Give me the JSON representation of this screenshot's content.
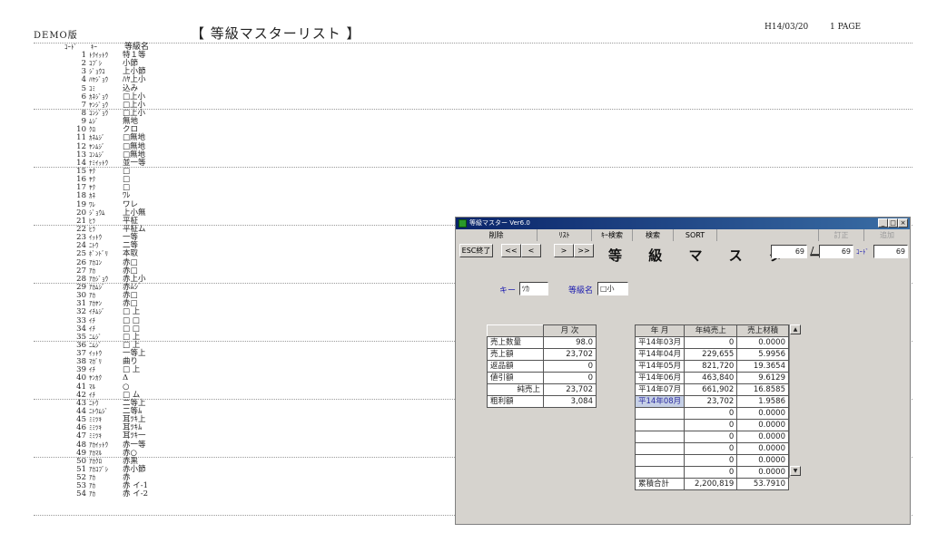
{
  "report": {
    "demo_label": "DEMO版",
    "title": "【 等級マスターリスト 】",
    "date": "H14/03/20",
    "page": "1 PAGE",
    "headers": {
      "code": "ｺｰﾄﾞ",
      "key": "ｷｰ",
      "name": "等級名"
    },
    "rows": [
      {
        "code": "1",
        "key": "ﾄｸｲｯﾄｳ",
        "name": "特１等"
      },
      {
        "code": "2",
        "key": "ｺﾌﾞｼ",
        "name": "小節"
      },
      {
        "code": "3",
        "key": "ｼﾞｮｳｺ",
        "name": "上小節"
      },
      {
        "code": "4",
        "key": "ﾊﾔｼﾞｮｳ",
        "name": "ﾊﾔ上小"
      },
      {
        "code": "5",
        "key": "ｺﾐ",
        "name": "込み"
      },
      {
        "code": "6",
        "key": "ｶﾈｼﾞｮｳ",
        "name": "□上小"
      },
      {
        "code": "7",
        "key": "ﾔﾝｼﾞｮｳ",
        "name": "□上小"
      },
      {
        "code": "8",
        "key": "ｺﾝｼﾞｮｳ",
        "name": "□上小"
      },
      {
        "code": "9",
        "key": "ﾑｼﾞ",
        "name": "無地"
      },
      {
        "code": "10",
        "key": "ｸﾛ",
        "name": "クロ"
      },
      {
        "code": "11",
        "key": "ｶﾈﾑｼﾞ",
        "name": "□無地"
      },
      {
        "code": "12",
        "key": "ﾔﾝﾑｼﾞ",
        "name": "□無地"
      },
      {
        "code": "13",
        "key": "ｺﾝﾑｼﾞ",
        "name": "□無地"
      },
      {
        "code": "14",
        "key": "ﾅﾐｲｯﾄｳ",
        "name": "並一等"
      },
      {
        "code": "15",
        "key": "ﾔｸ",
        "name": "□"
      },
      {
        "code": "16",
        "key": "ﾔｸ",
        "name": "□"
      },
      {
        "code": "17",
        "key": "ﾔｸ",
        "name": "□"
      },
      {
        "code": "18",
        "key": "ｶﾈ",
        "name": "ﾜﾚ"
      },
      {
        "code": "19",
        "key": "ﾜﾚ",
        "name": "ワレ"
      },
      {
        "code": "20",
        "key": "ｼﾞｮｳﾑ",
        "name": "上小無"
      },
      {
        "code": "21",
        "key": "ﾋﾗ",
        "name": "平柾"
      },
      {
        "code": "22",
        "key": "ﾋﾗ",
        "name": "平柾ム"
      },
      {
        "code": "23",
        "key": "ｲｯﾄｳ",
        "name": "一等"
      },
      {
        "code": "24",
        "key": "ﾆﾄｳ",
        "name": "二等"
      },
      {
        "code": "25",
        "key": "ﾎﾞﾝﾄﾞﾘ",
        "name": "本取"
      },
      {
        "code": "26",
        "key": "ｱｶｺﾝ",
        "name": "赤□"
      },
      {
        "code": "27",
        "key": "ｱｶ",
        "name": "赤□"
      },
      {
        "code": "28",
        "key": "ｱｶｼﾞｮｳ",
        "name": "赤上小"
      },
      {
        "code": "29",
        "key": "ｱｶﾑｼﾞ",
        "name": "赤ﾑｼﾞ"
      },
      {
        "code": "30",
        "key": "ｱｶ",
        "name": "赤□"
      },
      {
        "code": "31",
        "key": "ｱｶﾔﾝ",
        "name": "赤□"
      },
      {
        "code": "32",
        "key": "ｲﾁﾑｼﾞ",
        "name": "□ 上"
      },
      {
        "code": "33",
        "key": "ｲﾁ",
        "name": "□ □"
      },
      {
        "code": "34",
        "key": "ｲﾁ",
        "name": "□ □"
      },
      {
        "code": "35",
        "key": "ﾆﾑｼﾞ",
        "name": "□ 上"
      },
      {
        "code": "36",
        "key": "ﾆﾑｼﾞ",
        "name": "□ 上"
      },
      {
        "code": "37",
        "key": "ｲｯﾄｳ",
        "name": "一等上"
      },
      {
        "code": "38",
        "key": "ﾏｶﾞﾘ",
        "name": "曲り"
      },
      {
        "code": "39",
        "key": "ｲﾁ",
        "name": "□ 上"
      },
      {
        "code": "40",
        "key": "ﾔﾝｶｸ",
        "name": "Δ"
      },
      {
        "code": "41",
        "key": "ﾏﾙ",
        "name": "○"
      },
      {
        "code": "42",
        "key": "ｲﾁ",
        "name": "□ ム"
      },
      {
        "code": "43",
        "key": "ﾆﾄｳ",
        "name": "二等上"
      },
      {
        "code": "44",
        "key": "ﾆﾄｳﾑｼﾞ",
        "name": "二等ﾑ"
      },
      {
        "code": "45",
        "key": "ﾐﾐﾂｷ",
        "name": "耳ﾂｷ上"
      },
      {
        "code": "46",
        "key": "ﾐﾐﾂｷ",
        "name": "耳ﾂｷﾑ"
      },
      {
        "code": "47",
        "key": "ﾐﾐﾂｷ",
        "name": "耳ﾂｷ一"
      },
      {
        "code": "48",
        "key": "ｱｶｲｯﾄｳ",
        "name": "赤一等"
      },
      {
        "code": "49",
        "key": "ｱｶﾏﾙ",
        "name": "赤○"
      },
      {
        "code": "50",
        "key": "ｱｶｸﾛ",
        "name": "赤黒"
      },
      {
        "code": "51",
        "key": "ｱｶｺﾌﾞｼ",
        "name": "赤小節"
      },
      {
        "code": "52",
        "key": "ｱｶ",
        "name": "赤"
      },
      {
        "code": "53",
        "key": "ｱｶ",
        "name": "赤 イ-1"
      },
      {
        "code": "54",
        "key": "ｱｶ",
        "name": "赤 イ-2"
      }
    ]
  },
  "window": {
    "title": "等級マスター Ver6.0",
    "controls": {
      "minimize": "_",
      "maximize": "□",
      "close": "×"
    },
    "menu": [
      {
        "label": "削除",
        "enabled": true
      },
      {
        "label": "ﾘｽﾄ",
        "enabled": true
      },
      {
        "label": "ｷｰ検索",
        "enabled": true
      },
      {
        "label": "検索",
        "enabled": true
      },
      {
        "label": "SORT",
        "enabled": true
      },
      {
        "label": "",
        "enabled": true
      },
      {
        "label": "訂正",
        "enabled": false
      },
      {
        "label": "追加",
        "enabled": false
      }
    ],
    "toolbar": {
      "esc": "ESC終了",
      "first": "<<",
      "prev": "<",
      "next": ">",
      "last": ">>",
      "heading": "等 級 マ ス タ ー",
      "current": "69",
      "slash": "/",
      "total": "69",
      "code_label": "ｺｰﾄﾞ",
      "code": "69"
    },
    "form": {
      "key_label": "キー",
      "key_value": "ﾂｶ",
      "name_label": "等級名",
      "name_value": "□小"
    },
    "monthly": {
      "header": "月 次",
      "rows": [
        {
          "label": "売上数量",
          "value": "98.0"
        },
        {
          "label": "売上額",
          "value": "23,702"
        },
        {
          "label": "返品額",
          "value": "0"
        },
        {
          "label": "値引額",
          "value": "0"
        },
        {
          "label": "純売上",
          "value": "23,702"
        },
        {
          "label": "粗利額",
          "value": "3,084"
        }
      ]
    },
    "history": {
      "headers": [
        "年 月",
        "年純売上",
        "売上材積"
      ],
      "rows": [
        {
          "ym": "平14年03月",
          "sales": "0",
          "volume": "0.0000"
        },
        {
          "ym": "平14年04月",
          "sales": "229,655",
          "volume": "5.9956"
        },
        {
          "ym": "平14年05月",
          "sales": "821,720",
          "volume": "19.3654"
        },
        {
          "ym": "平14年06月",
          "sales": "463,840",
          "volume": "9.6129"
        },
        {
          "ym": "平14年07月",
          "sales": "661,902",
          "volume": "16.8585"
        },
        {
          "ym": "平14年08月",
          "sales": "23,702",
          "volume": "1.9586"
        },
        {
          "ym": "",
          "sales": "0",
          "volume": "0.0000"
        },
        {
          "ym": "",
          "sales": "0",
          "volume": "0.0000"
        },
        {
          "ym": "",
          "sales": "0",
          "volume": "0.0000"
        },
        {
          "ym": "",
          "sales": "0",
          "volume": "0.0000"
        },
        {
          "ym": "",
          "sales": "0",
          "volume": "0.0000"
        },
        {
          "ym": "",
          "sales": "0",
          "volume": "0.0000"
        }
      ],
      "total_label": "累積合計",
      "total_sales": "2,200,819",
      "total_volume": "53.7910",
      "scroll_up": "▲",
      "scroll_down": "▼"
    }
  }
}
